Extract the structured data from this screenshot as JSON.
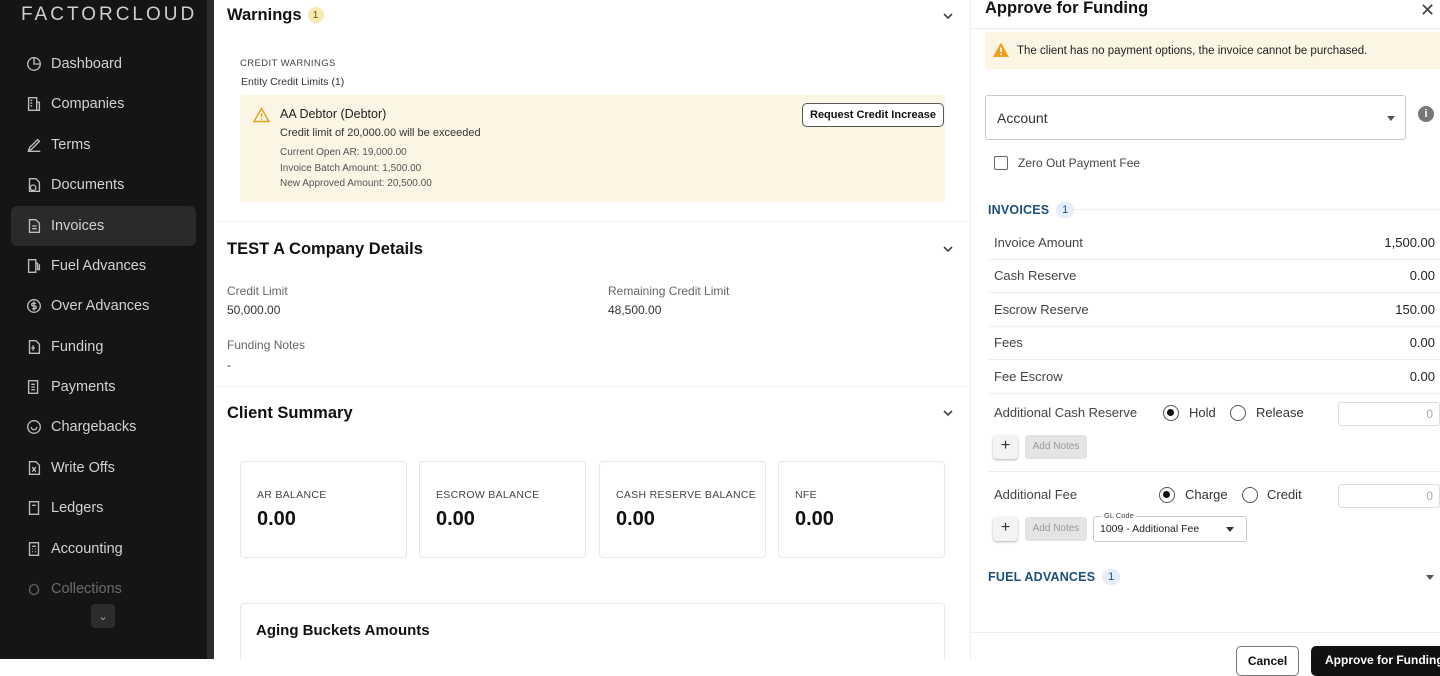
{
  "brand": "FACTORCLOUD",
  "sidebar": {
    "items": [
      {
        "label": "Dashboard",
        "icon": "dashboard-icon"
      },
      {
        "label": "Companies",
        "icon": "companies-icon"
      },
      {
        "label": "Terms",
        "icon": "terms-icon"
      },
      {
        "label": "Documents",
        "icon": "documents-icon"
      },
      {
        "label": "Invoices",
        "icon": "invoices-icon",
        "active": true
      },
      {
        "label": "Fuel Advances",
        "icon": "fuel-icon"
      },
      {
        "label": "Over Advances",
        "icon": "dollar-icon"
      },
      {
        "label": "Funding",
        "icon": "funding-icon"
      },
      {
        "label": "Payments",
        "icon": "payments-icon"
      },
      {
        "label": "Chargebacks",
        "icon": "chargebacks-icon"
      },
      {
        "label": "Write Offs",
        "icon": "write-offs-icon"
      },
      {
        "label": "Ledgers",
        "icon": "ledgers-icon"
      },
      {
        "label": "Accounting",
        "icon": "accounting-icon"
      },
      {
        "label": "Collections",
        "icon": "collections-icon"
      }
    ]
  },
  "warnings": {
    "title": "Warnings",
    "count": "1",
    "credit_warnings_label": "CREDIT WARNINGS",
    "entity_limits_label": "Entity Credit Limits (1)",
    "entity": "AA Debtor (Debtor)",
    "message": "Credit limit of 20,000.00 will be exceeded",
    "current_open_ar": "Current Open AR: 19,000.00",
    "batch_amount": "Invoice Batch Amount: 1,500.00",
    "new_approved": "New Approved Amount: 20,500.00",
    "request_button": "Request Credit Increase"
  },
  "company": {
    "title": "TEST A Company Details",
    "credit_limit_label": "Credit Limit",
    "credit_limit": "50,000.00",
    "remaining_label": "Remaining Credit Limit",
    "remaining": "48,500.00",
    "funding_notes_label": "Funding Notes",
    "funding_notes": "-"
  },
  "client_summary": {
    "title": "Client Summary",
    "cards": [
      {
        "label": "AR BALANCE",
        "value": "0.00"
      },
      {
        "label": "ESCROW BALANCE",
        "value": "0.00"
      },
      {
        "label": "CASH RESERVE BALANCE",
        "value": "0.00"
      },
      {
        "label": "NFE",
        "value": "0.00"
      }
    ],
    "aging_title": "Aging Buckets Amounts"
  },
  "panel": {
    "title": "Approve for Funding",
    "alert": "The client has no payment options, the invoice cannot be purchased.",
    "account_label": "Account",
    "zero_fee_label": "Zero Out Payment Fee",
    "invoices_title": "INVOICES",
    "invoices_count": "1",
    "rows": [
      {
        "label": "Invoice Amount",
        "value": "1,500.00"
      },
      {
        "label": "Cash Reserve",
        "value": "0.00"
      },
      {
        "label": "Escrow Reserve",
        "value": "150.00"
      },
      {
        "label": "Fees",
        "value": "0.00"
      },
      {
        "label": "Fee Escrow",
        "value": "0.00"
      }
    ],
    "additional_cash_reserve": {
      "label": "Additional Cash Reserve",
      "opt1": "Hold",
      "opt2": "Release",
      "value": "0"
    },
    "additional_fee": {
      "label": "Additional Fee",
      "opt1": "Charge",
      "opt2": "Credit",
      "value": "0"
    },
    "add_notes": "Add Notes",
    "gl_code_label": "GL Code",
    "gl_code_value": "1009 - Additional Fee",
    "fuel_title": "FUEL ADVANCES",
    "fuel_count": "1",
    "cancel_label": "Cancel",
    "approve_label": "Approve for Funding"
  }
}
